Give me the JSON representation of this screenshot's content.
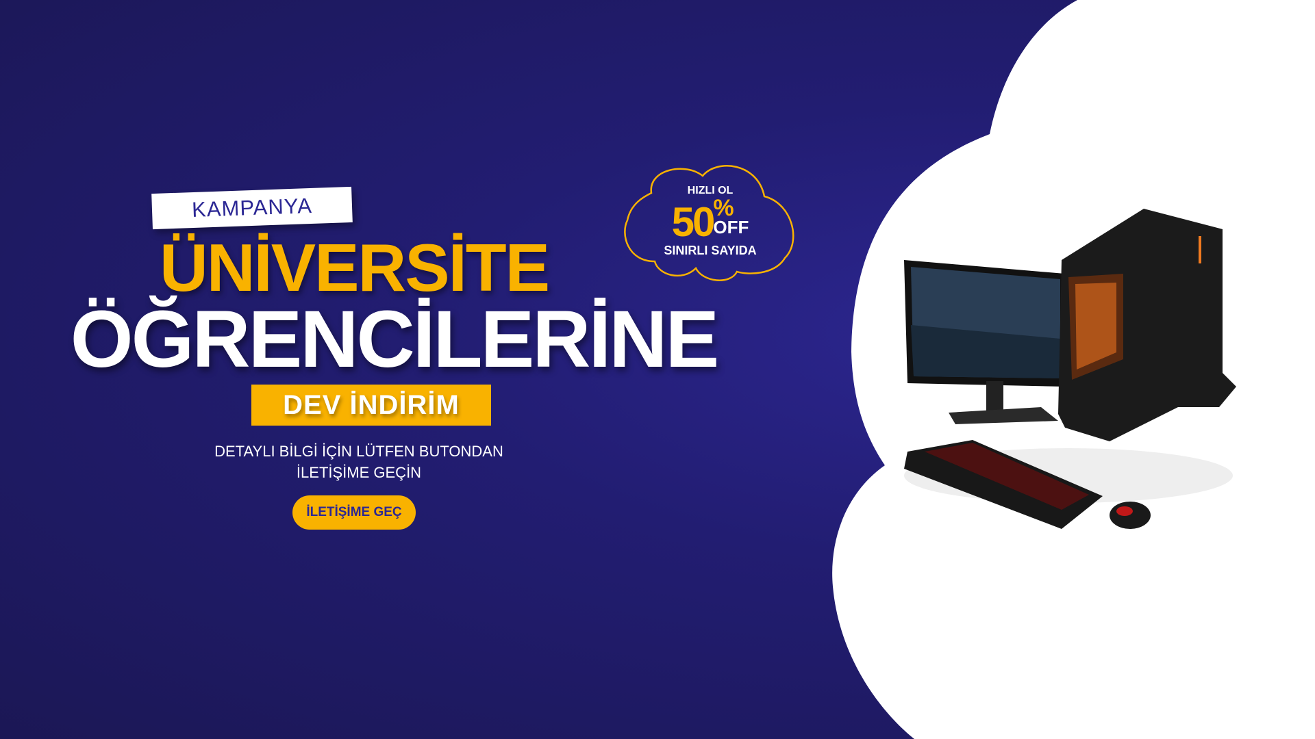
{
  "tag": "KAMPANYA",
  "headline_line1": "ÜNİVERSİTE",
  "headline_line2": "ÖĞRENCİLERİNE",
  "highlight": "DEV İNDİRİM",
  "info_line1": "DETAYLI BİLGİ İÇİN LÜTFEN BUTONDAN",
  "info_line2": "İLETİŞİME GEÇİN",
  "cta_button": "İLETİŞİME GEÇ",
  "badge": {
    "top": "HIZLI OL",
    "percent": "50",
    "percent_sign": "%",
    "off": "OFF",
    "bottom": "SINIRLI SAYIDA"
  },
  "colors": {
    "accent": "#f9b200",
    "navy": "#221d72",
    "text_blue": "#2b2794"
  }
}
